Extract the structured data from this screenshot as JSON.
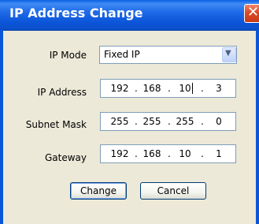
{
  "window": {
    "title": "IP Address Change",
    "close_glyph": "✕"
  },
  "form": {
    "ip_mode": {
      "label": "IP Mode",
      "value": "Fixed IP",
      "dropdown_icon": "chevron-down-icon"
    },
    "ip_address": {
      "label": "IP Address",
      "octets": [
        "192",
        "168",
        "10",
        "3"
      ]
    },
    "subnet_mask": {
      "label": "Subnet Mask",
      "octets": [
        "255",
        "255",
        "255",
        "0"
      ]
    },
    "gateway": {
      "label": "Gateway",
      "octets": [
        "192",
        "168",
        "10",
        "1"
      ]
    },
    "separator": "."
  },
  "buttons": {
    "change_label": "Change",
    "cancel_label": "Cancel"
  },
  "colors": {
    "titlebar": "#0b55d8",
    "window_bg": "#ece9d8",
    "close_button": "#dc4a26",
    "field_border": "#7f9db9"
  }
}
